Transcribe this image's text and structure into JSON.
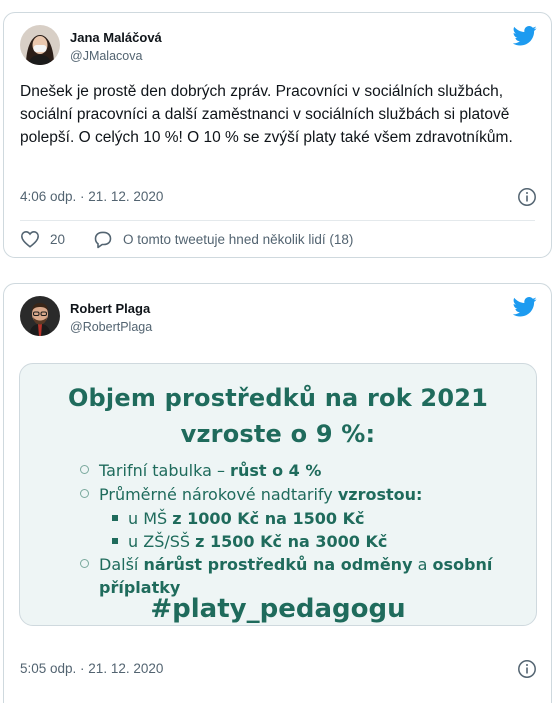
{
  "tweets": [
    {
      "name": "Jana Maláčová",
      "handle": "@JMalacova",
      "text": "Dnešek je prostě den dobrých zpráv. Pracovníci v sociálních službách, sociální pracovníci a další zaměstnanci v sociálních službách si platově polepší.  O celých 10 %! O 10 % se zvýší platy také všem zdravotníkům.",
      "time": "4:06 odp. · 21. 12. 2020",
      "likes": "20",
      "reply_label": "O tomto tweetuje hned několik lidí (18)"
    },
    {
      "name": "Robert Plaga",
      "handle": "@RobertPlaga",
      "time": "5:05 odp. · 21. 12. 2020",
      "media": {
        "title_line1": "Objem prostředků na rok 2021",
        "title_line2": "vzroste o 9 %:",
        "item1_a": "Tarifní tabulka – ",
        "item1_b": "růst o 4 %",
        "item2_a": "Průměrné nárokové nadtarify ",
        "item2_b": "vzrostou:",
        "sub1_a": "u MŠ ",
        "sub1_b": "z 1000 Kč na 1500 Kč",
        "sub2_a": "u ZŠ/SŠ ",
        "sub2_b": "z 1500 Kč na 3000 Kč",
        "item3_a": "Další ",
        "item3_b": "nárůst prostředků na odměny",
        "item3_c": " a ",
        "item3_d": "osobní",
        "item3_e": "příplatky",
        "hashtag": "#platy_pedagogu"
      }
    }
  ],
  "colors": {
    "twitter_blue": "#1d9bf0",
    "media_green": "#1f6b5c",
    "muted": "#536471"
  }
}
